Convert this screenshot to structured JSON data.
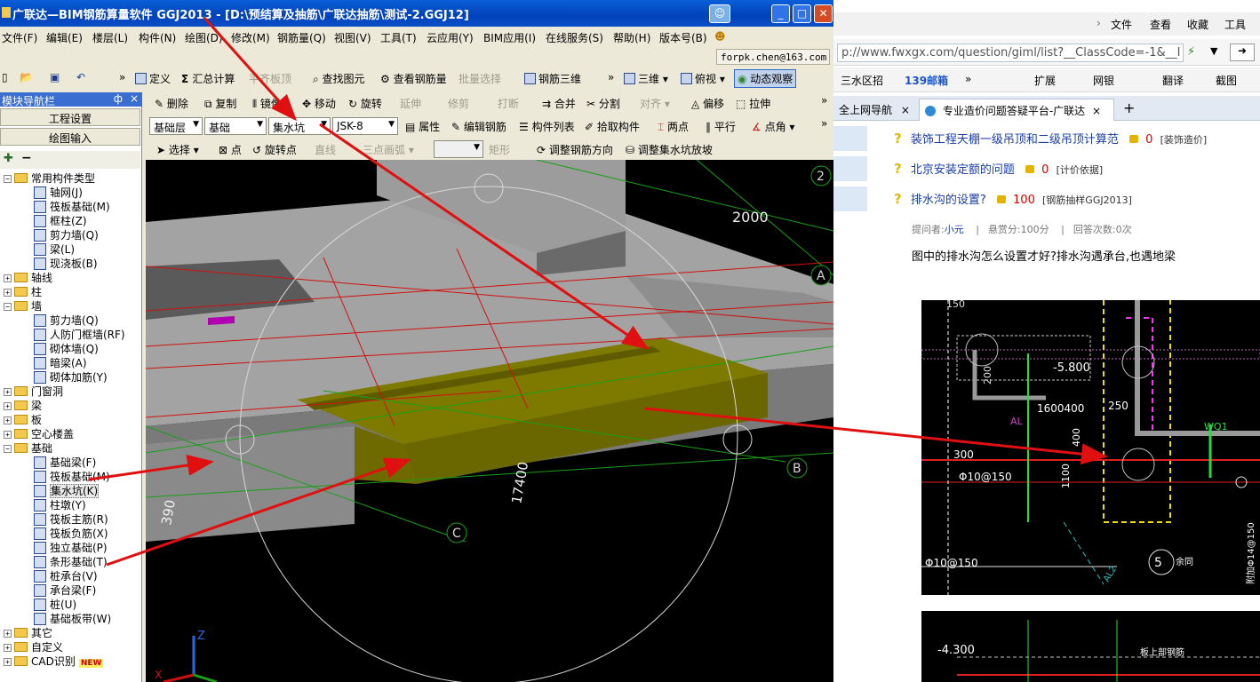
{
  "browser": {
    "menu": [
      "文件",
      "查看",
      "收藏",
      "工具"
    ],
    "url": "p://www.fwxgx.com/question/giml/list?__ClassCode=-1&__I",
    "url_domain": "fwxgx.com",
    "favorites": [
      "三水区招",
      "139邮箱",
      "扩展",
      "网银",
      "翻译",
      "截图"
    ],
    "tabs": [
      {
        "label": "全上网导航",
        "close": "×"
      },
      {
        "label": "专业造价问题答疑平台-广联达",
        "close": "×"
      }
    ],
    "new_tab": "+",
    "questions": [
      {
        "title": "装饰工程天棚一级吊顶和二级吊顶计算范",
        "reward": "0",
        "tag": "[装饰造价]"
      },
      {
        "title": "北京安装定额的问题",
        "reward": "0",
        "tag": "[计价依据]"
      },
      {
        "title": "排水沟的设置?",
        "reward": "100",
        "tag": "[钢筋抽样GGJ2013]"
      }
    ],
    "meta": {
      "asker_label": "提问者:",
      "asker": "小元",
      "reward_text": "悬赏分:100分",
      "answers_text": "回答次数:0次"
    },
    "question_body": "图中的排水沟怎么设置才好?排水沟遇承台,也遇地梁",
    "cad_labels": [
      "150",
      "-5.800",
      "1600400",
      "250",
      "200",
      "AL",
      "400",
      "300",
      "Φ10@150",
      "1100",
      "WQ1",
      "Φ10@150",
      "5",
      "余同",
      "附加Φ14@150",
      "AL2",
      "-4.300",
      "板上部钢筋"
    ]
  },
  "app": {
    "title": "广联达—BIM钢筋算量软件 GGJ2013 - [D:\\预结算及抽筋\\广联达抽筋\\测试-2.GGJ12]",
    "menu": [
      "文件(F)",
      "编辑(E)",
      "楼层(L)",
      "构件(N)",
      "绘图(D)",
      "修改(M)",
      "钢筋量(Q)",
      "视图(V)",
      "工具(T)",
      "云应用(Y)",
      "BIM应用(I)",
      "在线服务(S)",
      "帮助(H)",
      "版本号(B)"
    ],
    "user": "forpk.chen@163.com",
    "toolbar1": {
      "define": "定义",
      "sum": "汇总计算",
      "flat_top": "平齐板顶",
      "find": "查找图元",
      "view_rebar": "查看钢筋量",
      "batch_select": "批量选择",
      "rebar_3d": "钢筋三维",
      "three_d": "三维",
      "top_view": "俯视",
      "dynamic": "动态观察"
    },
    "toolbar2": {
      "delete": "删除",
      "copy": "复制",
      "mirror": "镜像",
      "move": "移动",
      "rotate": "旋转",
      "extend": "延伸",
      "trim": "修剪",
      "break": "打断",
      "merge": "合并",
      "split": "分割",
      "align": "对齐",
      "offset": "偏移",
      "stretch": "拉伸"
    },
    "toolbar3": {
      "floor": "基础层",
      "category": "基础",
      "type": "集水坑",
      "element": "JSK-8",
      "props": "属性",
      "edit_rebar": "编辑钢筋",
      "list": "构件列表",
      "pick": "拾取构件",
      "two_point": "两点",
      "parallel": "平行",
      "point_angle": "点角"
    },
    "toolbar4": {
      "select": "选择",
      "point": "点",
      "rotate_point": "旋转点",
      "line": "直线",
      "arc": "三点画弧",
      "rect": "矩形",
      "adjust_dir": "调整钢筋方向",
      "adjust_slope": "调整集水坑放坡"
    },
    "nav": {
      "title": "模块导航栏",
      "pin": "ф",
      "close": "×",
      "btn_project": "工程设置",
      "btn_draw": "绘图输入",
      "tree": [
        {
          "label": "常用构件类型",
          "level": 0,
          "kind": "folder",
          "expanded": true
        },
        {
          "label": "轴网(J)",
          "level": 1,
          "kind": "leaf"
        },
        {
          "label": "筏板基础(M)",
          "level": 1,
          "kind": "leaf"
        },
        {
          "label": "框柱(Z)",
          "level": 1,
          "kind": "leaf"
        },
        {
          "label": "剪力墙(Q)",
          "level": 1,
          "kind": "leaf"
        },
        {
          "label": "梁(L)",
          "level": 1,
          "kind": "leaf"
        },
        {
          "label": "现浇板(B)",
          "level": 1,
          "kind": "leaf"
        },
        {
          "label": "轴线",
          "level": 0,
          "kind": "folder",
          "expanded": false
        },
        {
          "label": "柱",
          "level": 0,
          "kind": "folder",
          "expanded": false
        },
        {
          "label": "墙",
          "level": 0,
          "kind": "folder",
          "expanded": true
        },
        {
          "label": "剪力墙(Q)",
          "level": 1,
          "kind": "leaf"
        },
        {
          "label": "人防门框墙(RF)",
          "level": 1,
          "kind": "leaf"
        },
        {
          "label": "砌体墙(Q)",
          "level": 1,
          "kind": "leaf"
        },
        {
          "label": "暗梁(A)",
          "level": 1,
          "kind": "leaf"
        },
        {
          "label": "砌体加筋(Y)",
          "level": 1,
          "kind": "leaf"
        },
        {
          "label": "门窗洞",
          "level": 0,
          "kind": "folder",
          "expanded": false
        },
        {
          "label": "梁",
          "level": 0,
          "kind": "folder",
          "expanded": false
        },
        {
          "label": "板",
          "level": 0,
          "kind": "folder",
          "expanded": false
        },
        {
          "label": "空心楼盖",
          "level": 0,
          "kind": "folder",
          "expanded": false
        },
        {
          "label": "基础",
          "level": 0,
          "kind": "folder",
          "expanded": true
        },
        {
          "label": "基础梁(F)",
          "level": 1,
          "kind": "leaf"
        },
        {
          "label": "筏板基础(M)",
          "level": 1,
          "kind": "leaf"
        },
        {
          "label": "集水坑(K)",
          "level": 1,
          "kind": "leaf",
          "selected": true
        },
        {
          "label": "柱墩(Y)",
          "level": 1,
          "kind": "leaf"
        },
        {
          "label": "筏板主筋(R)",
          "level": 1,
          "kind": "leaf"
        },
        {
          "label": "筏板负筋(X)",
          "level": 1,
          "kind": "leaf"
        },
        {
          "label": "独立基础(P)",
          "level": 1,
          "kind": "leaf"
        },
        {
          "label": "条形基础(T)",
          "level": 1,
          "kind": "leaf"
        },
        {
          "label": "桩承台(V)",
          "level": 1,
          "kind": "leaf"
        },
        {
          "label": "承台梁(F)",
          "level": 1,
          "kind": "leaf"
        },
        {
          "label": "桩(U)",
          "level": 1,
          "kind": "leaf"
        },
        {
          "label": "基础板带(W)",
          "level": 1,
          "kind": "leaf"
        },
        {
          "label": "其它",
          "level": 0,
          "kind": "folder",
          "expanded": false
        },
        {
          "label": "自定义",
          "level": 0,
          "kind": "folder",
          "expanded": false
        },
        {
          "label": "CAD识别",
          "level": 0,
          "kind": "folder",
          "expanded": false,
          "badge": "NEW"
        }
      ]
    },
    "viewport": {
      "dim_top": "2000",
      "dim_mid": "17400",
      "dim_left": "390",
      "axis_2": "2",
      "axis_a": "A",
      "axis_b": "B",
      "axis_c": "C",
      "axis_z": "Z",
      "axis_x": "X"
    }
  }
}
